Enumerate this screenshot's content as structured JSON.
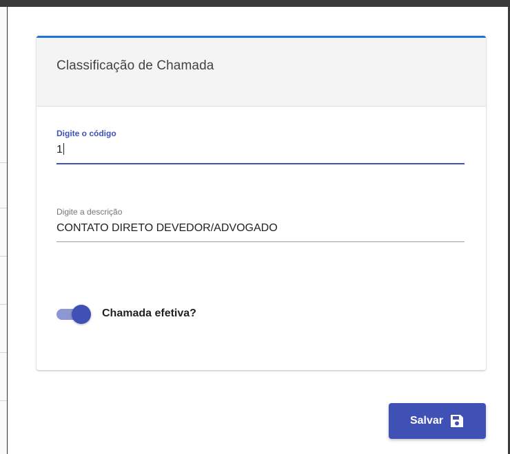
{
  "dialog": {
    "title": "Classificação de Chamada"
  },
  "form": {
    "code": {
      "label": "Digite o código",
      "value": "1"
    },
    "description": {
      "label": "Digite a descrição",
      "value": "CONTATO DIRETO DEVEDOR/ADVOGADO"
    },
    "effective_toggle": {
      "label": "Chamada efetiva?",
      "checked": true
    }
  },
  "actions": {
    "save_label": "Salvar",
    "save_icon": "floppy-disk-icon"
  },
  "colors": {
    "primary": "#3f51b5",
    "header_accent": "#1e73d8",
    "toggle_track": "#8c97d3",
    "header_bg": "#f4f4f4"
  }
}
